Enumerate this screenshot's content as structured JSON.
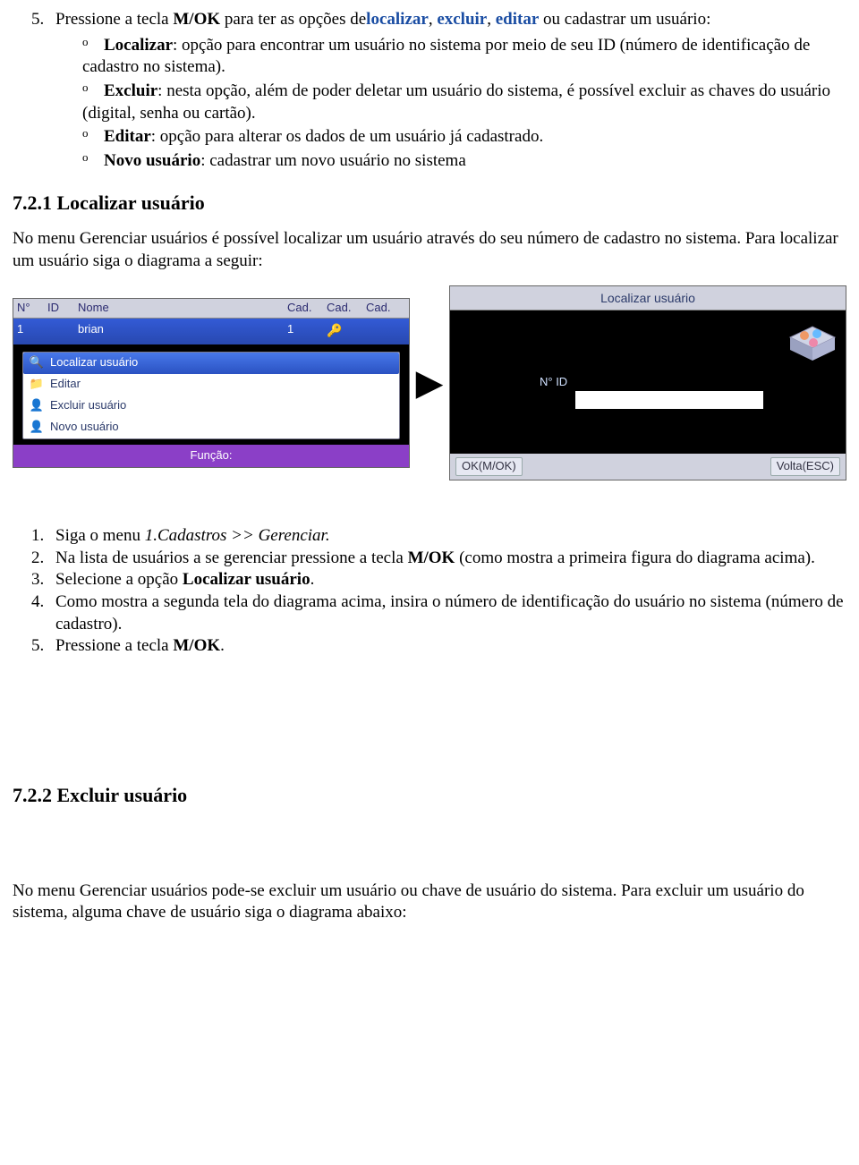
{
  "s5": {
    "text_pre": "Pressione a tecla ",
    "key": "M/OK",
    "text_mid": " para ter as opções de",
    "opt1": "localizar",
    "opt2": "excluir",
    "opt3": "editar",
    "text_tail": " ou cadastrar um usuário:"
  },
  "sub": {
    "o": "o",
    "loc_label": "Localizar",
    "loc_text": ": opção para encontrar um usuário no sistema por meio de seu ID (número de identificação de cadastro no sistema).",
    "exc_label": "Excluir",
    "exc_text": ": nesta opção, além de poder deletar um usuário do sistema, é possível excluir as chaves do usuário (digital, senha ou cartão).",
    "edt_label": "Editar",
    "edt_text": ": opção para alterar os dados de um usuário já cadastrado.",
    "nov_label": "Novo usuário",
    "nov_text": ": cadastrar um novo usuário no sistema"
  },
  "sec721": "7.2.1 Localizar usuário",
  "p721": "No menu Gerenciar usuários é possível localizar um usuário através do seu número de cadastro no sistema. Para localizar um usuário siga o diagrama a seguir:",
  "left": {
    "h1": "N°",
    "h2": "ID",
    "h3": "Nome",
    "h4": "Cad.",
    "h5": "Cad.",
    "h6": "Cad.",
    "r_id": "1",
    "r_nome": "brian",
    "r_cad": "1",
    "m1": "Localizar usuário",
    "m2": "Editar",
    "m3": "Excluir usuário",
    "m4": "Novo usuário",
    "footer": "Função:"
  },
  "right": {
    "title": "Localizar usuário",
    "id": "N° ID",
    "ok": "OK(M/OK)",
    "back": "Volta(ESC)"
  },
  "steps": {
    "s1a": "Siga o menu ",
    "s1b": "1.Cadastros >> Gerenciar.",
    "s2a": "Na lista de usuários a se gerenciar pressione a tecla ",
    "s2b": "M/OK",
    "s2c": " (como mostra a primeira figura do diagrama acima).",
    "s3a": "Selecione a opção ",
    "s3b": "Localizar usuário",
    "s3c": ".",
    "s4": "Como mostra a segunda tela do diagrama acima, insira o número de identificação do usuário no sistema (número de cadastro).",
    "s5a": "Pressione a tecla ",
    "s5b": "M/OK",
    "s5c": "."
  },
  "sec722": "7.2.2 Excluir usuário",
  "p722": "No menu Gerenciar usuários pode-se excluir um usuário ou chave de usuário do sistema. Para excluir um usuário do sistema, alguma chave de usuário siga o diagrama abaixo:"
}
